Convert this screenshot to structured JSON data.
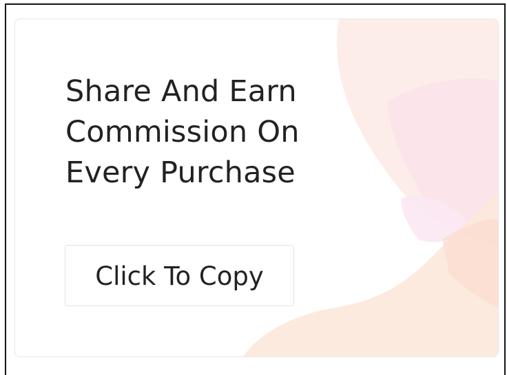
{
  "promo_card": {
    "headline_lines": [
      "Share And Earn",
      "Commission On",
      "Every Purchase"
    ],
    "copy_button_label": "Click To Copy"
  },
  "colors": {
    "background": "#ffffff",
    "text": "#222222",
    "blob_peach": "#fde9e2",
    "blob_pink": "#fbe3ea",
    "blob_orange": "#fde6d8"
  }
}
